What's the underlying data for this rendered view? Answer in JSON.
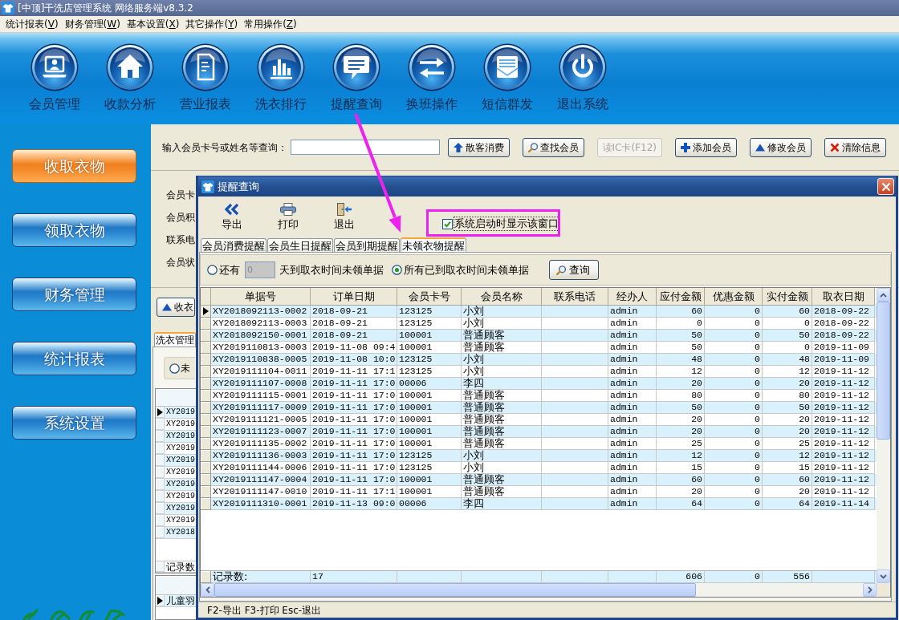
{
  "window": {
    "title": "[中顶]干洗店管理系统 网络服务端v8.3.2"
  },
  "menu": [
    "统计报表(V)",
    "财务管理(W)",
    "基本设置(X)",
    "其它操作(Y)",
    "常用操作(Z)"
  ],
  "toolbar": [
    "会员管理",
    "收款分析",
    "营业报表",
    "洗衣排行",
    "提醒查询",
    "换班操作",
    "短信群发",
    "退出系统"
  ],
  "sidebar": [
    {
      "label": "收取衣物",
      "selected": true
    },
    {
      "label": "领取衣物",
      "selected": false
    },
    {
      "label": "财务管理",
      "selected": false
    },
    {
      "label": "统计报表",
      "selected": false
    },
    {
      "label": "系统设置",
      "selected": false
    }
  ],
  "search": {
    "label": "输入会员卡号或姓名等查询：",
    "buttons": [
      {
        "label": "散客消费",
        "disabled": false
      },
      {
        "label": "查找会员",
        "disabled": false
      },
      {
        "label": "读IC卡(F12)",
        "disabled": true
      },
      {
        "label": "添加会员",
        "disabled": false
      },
      {
        "label": "修改会员",
        "disabled": false
      },
      {
        "label": "清除信息",
        "disabled": false
      }
    ]
  },
  "member_form": {
    "labels": [
      "会员卡",
      "会员积",
      "联系电",
      "会员状"
    ],
    "button": "收衣",
    "tabs": [
      {
        "label": "洗衣管理",
        "selected": true
      }
    ],
    "filter": {
      "label": "未",
      "selected": false
    },
    "orders": {
      "rows": [
        {
          "selected": true,
          "column_1": "XY2019"
        },
        {
          "selected": false,
          "column_1": "XY2019"
        },
        {
          "selected": false,
          "column_1": "XY2019"
        },
        {
          "selected": false,
          "column_1": "XY2019"
        },
        {
          "selected": false,
          "column_1": "XY2019"
        },
        {
          "selected": false,
          "column_1": "XY2019"
        },
        {
          "selected": false,
          "column_1": "XY2019"
        },
        {
          "selected": false,
          "column_1": "XY2019"
        },
        {
          "selected": false,
          "column_1": "XY2019"
        },
        {
          "selected": false,
          "column_1": "XY2019"
        },
        {
          "selected": false,
          "column_1": "XY2018"
        }
      ],
      "footer": "记录数"
    },
    "items": {
      "rows": [
        {
          "selected": true,
          "column_1": "儿童羽"
        }
      ]
    }
  },
  "dialog": {
    "title": "提醒查询",
    "toolbar": [
      "导出",
      "打印",
      "退出"
    ],
    "startup_option": {
      "label": "系统启动时显示该窗口",
      "checked": true
    },
    "tabs": [
      {
        "label": "会员消费提醒",
        "selected": false
      },
      {
        "label": "会员生日提醒",
        "selected": false
      },
      {
        "label": "会员到期提醒",
        "selected": false
      },
      {
        "label": "未领衣物提醒",
        "selected": true
      }
    ],
    "filter": {
      "options": [
        {
          "label": "还有",
          "selected": false
        },
        {
          "label": "所有已到取衣时间未领单据",
          "selected": true
        }
      ],
      "days": {
        "value": "0",
        "disabled": true
      },
      "days_suffix": "天到取衣时间未领单据",
      "query_button": "查询"
    },
    "table": {
      "columns": [
        "单据号",
        "订单日期",
        "会员卡号",
        "会员名称",
        "联系电话",
        "经办人",
        "应付金额",
        "优惠金额",
        "实付金额",
        "取衣日期"
      ],
      "rows": [
        {
          "selected": true,
          "order_no": "XY2018092113-0002",
          "order_date": "2018-09-21",
          "card_no": "123125",
          "member": "小刘",
          "handler": "admin",
          "payable": "60",
          "discount": "0",
          "paid": "60",
          "pickup_date": "2018-09-22"
        },
        {
          "selected": false,
          "order_no": "XY2018092113-0003",
          "order_date": "2018-09-21",
          "card_no": "123125",
          "member": "小刘",
          "handler": "admin",
          "payable": "0",
          "discount": "0",
          "paid": "0",
          "pickup_date": "2018-09-22"
        },
        {
          "selected": false,
          "order_no": "XY2018092150-0001",
          "order_date": "2018-09-21",
          "card_no": "100001",
          "member": "普通顾客",
          "handler": "admin",
          "payable": "50",
          "discount": "0",
          "paid": "50",
          "pickup_date": "2018-09-22"
        },
        {
          "selected": false,
          "order_no": "XY2019110813-0003",
          "order_date": "2019-11-08 09:4",
          "card_no": "100001",
          "member": "普通顾客",
          "handler": "admin",
          "payable": "50",
          "discount": "0",
          "paid": "0",
          "pickup_date": "2019-11-09"
        },
        {
          "selected": false,
          "order_no": "XY2019110838-0005",
          "order_date": "2019-11-08 10:0",
          "card_no": "123125",
          "member": "小刘",
          "handler": "admin",
          "payable": "48",
          "discount": "0",
          "paid": "48",
          "pickup_date": "2019-11-09"
        },
        {
          "selected": false,
          "order_no": "XY2019111104-0011",
          "order_date": "2019-11-11 17:1",
          "card_no": "123125",
          "member": "小刘",
          "handler": "admin",
          "payable": "12",
          "discount": "0",
          "paid": "12",
          "pickup_date": "2019-11-12"
        },
        {
          "selected": false,
          "order_no": "XY2019111107-0008",
          "order_date": "2019-11-11 17:0",
          "card_no": "00006",
          "member": "李四",
          "handler": "admin",
          "payable": "20",
          "discount": "0",
          "paid": "20",
          "pickup_date": "2019-11-12"
        },
        {
          "selected": false,
          "order_no": "XY2019111115-0001",
          "order_date": "2019-11-11 17:0",
          "card_no": "100001",
          "member": "普通顾客",
          "handler": "admin",
          "payable": "80",
          "discount": "0",
          "paid": "80",
          "pickup_date": "2019-11-12"
        },
        {
          "selected": false,
          "order_no": "XY2019111117-0009",
          "order_date": "2019-11-11 17:0",
          "card_no": "100001",
          "member": "普通顾客",
          "handler": "admin",
          "payable": "50",
          "discount": "0",
          "paid": "50",
          "pickup_date": "2019-11-12"
        },
        {
          "selected": false,
          "order_no": "XY2019111121-0005",
          "order_date": "2019-11-11 17:0",
          "card_no": "100001",
          "member": "普通顾客",
          "handler": "admin",
          "payable": "20",
          "discount": "0",
          "paid": "20",
          "pickup_date": "2019-11-12"
        },
        {
          "selected": false,
          "order_no": "XY2019111123-0007",
          "order_date": "2019-11-11 17:0",
          "card_no": "100001",
          "member": "普通顾客",
          "handler": "admin",
          "payable": "20",
          "discount": "0",
          "paid": "20",
          "pickup_date": "2019-11-12"
        },
        {
          "selected": false,
          "order_no": "XY2019111135-0002",
          "order_date": "2019-11-11 17:0",
          "card_no": "100001",
          "member": "普通顾客",
          "handler": "admin",
          "payable": "25",
          "discount": "0",
          "paid": "25",
          "pickup_date": "2019-11-12"
        },
        {
          "selected": false,
          "order_no": "XY2019111136-0003",
          "order_date": "2019-11-11 17:0",
          "card_no": "123125",
          "member": "小刘",
          "handler": "admin",
          "payable": "12",
          "discount": "0",
          "paid": "12",
          "pickup_date": "2019-11-12"
        },
        {
          "selected": false,
          "order_no": "XY2019111144-0006",
          "order_date": "2019-11-11 17:0",
          "card_no": "123125",
          "member": "小刘",
          "handler": "admin",
          "payable": "15",
          "discount": "0",
          "paid": "15",
          "pickup_date": "2019-11-12"
        },
        {
          "selected": false,
          "order_no": "XY2019111147-0004",
          "order_date": "2019-11-11 17:0",
          "card_no": "100001",
          "member": "普通顾客",
          "handler": "admin",
          "payable": "60",
          "discount": "0",
          "paid": "60",
          "pickup_date": "2019-11-12"
        },
        {
          "selected": false,
          "order_no": "XY2019111147-0010",
          "order_date": "2019-11-11 17:1",
          "card_no": "100001",
          "member": "普通顾客",
          "handler": "admin",
          "payable": "20",
          "discount": "0",
          "paid": "20",
          "pickup_date": "2019-11-12"
        },
        {
          "selected": false,
          "order_no": "XY2019111310-0001",
          "order_date": "2019-11-13 09:0",
          "card_no": "00006",
          "member": "李四",
          "handler": "admin",
          "payable": "64",
          "discount": "0",
          "paid": "64",
          "pickup_date": "2019-11-14"
        }
      ],
      "footer": {
        "label": "记录数:",
        "count": "17",
        "payable": "606",
        "discount": "0",
        "paid": "556"
      }
    },
    "status_bar": "F2-导出 F3-打印 Esc-退出"
  }
}
